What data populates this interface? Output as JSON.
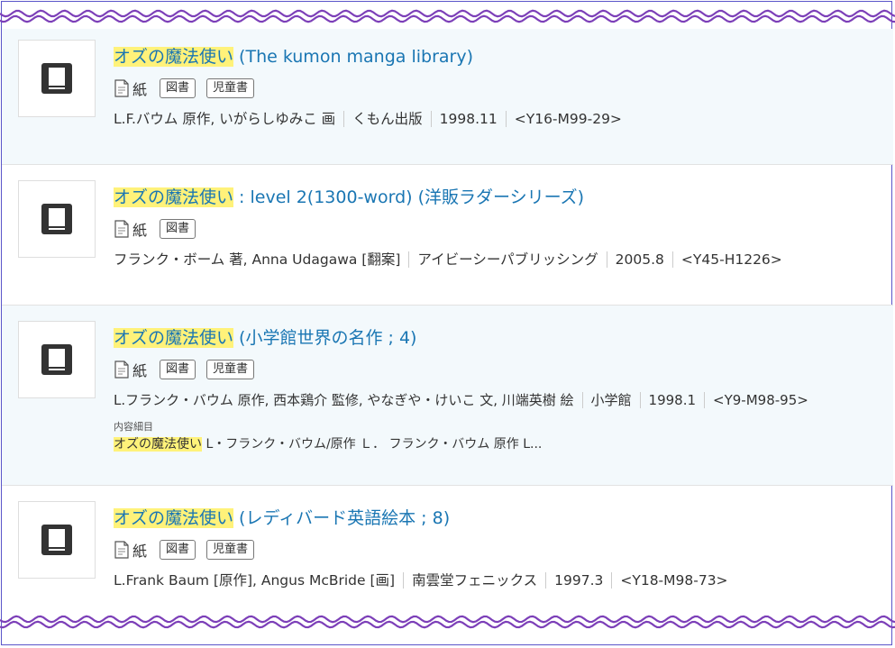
{
  "colors": {
    "title_link": "#1a76b3",
    "highlight": "#fff27a",
    "wave": "#7c3fb8",
    "frame": "#5a55c9",
    "row_alt_bg": "#f3f9fc"
  },
  "icons": {
    "thumbnail": "book-icon",
    "format": "paper-document-icon"
  },
  "results": [
    {
      "title_highlight": "オズの魔法使い",
      "title_rest": " (The kumon manga library)",
      "format": "紙",
      "tags": [
        "図書",
        "児童書"
      ],
      "authors": "L.F.バウム 原作, いがらしゆみこ 画",
      "publisher": "くもん出版",
      "date": "1998.11",
      "call_number": "<Y16-M99-29>"
    },
    {
      "title_highlight": "オズの魔法使い",
      "title_rest": " : level 2(1300-word) (洋販ラダーシリーズ)",
      "format": "紙",
      "tags": [
        "図書"
      ],
      "authors": "フランク・ボーム 著, Anna Udagawa [翻案]",
      "publisher": "アイビーシーパブリッシング",
      "date": "2005.8",
      "call_number": "<Y45-H1226>"
    },
    {
      "title_highlight": "オズの魔法使い",
      "title_rest": " (小学館世界の名作 ; 4)",
      "format": "紙",
      "tags": [
        "図書",
        "児童書"
      ],
      "authors": "L.フランク・バウム 原作, 西本鶏介 監修, やなぎや・けいこ 文, 川端英樹 絵",
      "publisher": "小学館",
      "date": "1998.1",
      "call_number": "<Y9-M98-95>",
      "detail_label": "内容細目",
      "detail_highlight": "オズの魔法使い",
      "detail_rest": " L・フランク・バウム/原作 Ｌ． フランク・バウム 原作 L..."
    },
    {
      "title_highlight": "オズの魔法使い",
      "title_rest": " (レディバード英語絵本 ; 8)",
      "format": "紙",
      "tags": [
        "図書",
        "児童書"
      ],
      "authors": "L.Frank Baum [原作], Angus McBride [画]",
      "publisher": "南雲堂フェニックス",
      "date": "1997.3",
      "call_number": "<Y18-M98-73>"
    }
  ]
}
